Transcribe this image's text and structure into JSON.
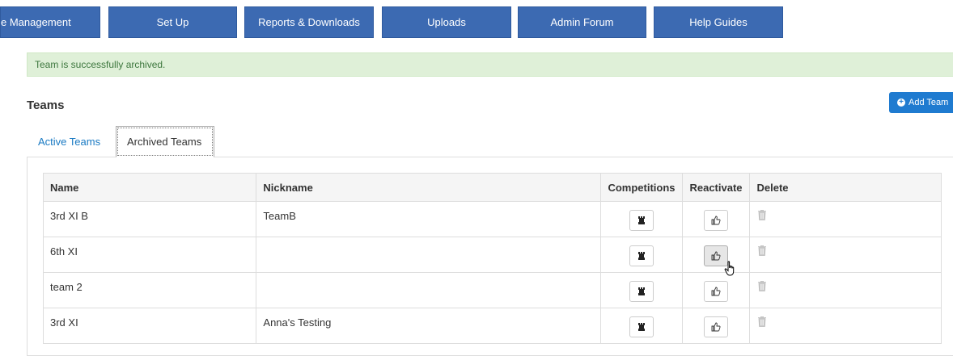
{
  "nav": {
    "items": [
      {
        "label": "e Management"
      },
      {
        "label": "Set Up"
      },
      {
        "label": "Reports & Downloads"
      },
      {
        "label": "Uploads"
      },
      {
        "label": "Admin Forum"
      },
      {
        "label": "Help Guides"
      }
    ],
    "color": "#3c6ab2"
  },
  "alert": {
    "text": "Team is successfully archived.",
    "color": "#dff0d8"
  },
  "page": {
    "heading": "Teams",
    "add_button": "Add Team"
  },
  "tabs": [
    {
      "label": "Active Teams",
      "selected": false
    },
    {
      "label": "Archived Teams",
      "selected": true
    }
  ],
  "table": {
    "headers": {
      "name": "Name",
      "nickname": "Nickname",
      "competitions": "Competitions",
      "reactivate": "Reactivate",
      "delete": "Delete"
    },
    "rows": [
      {
        "name": "3rd XI B",
        "nickname": "TeamB"
      },
      {
        "name": "6th XI",
        "nickname": ""
      },
      {
        "name": "team 2",
        "nickname": ""
      },
      {
        "name": "3rd XI",
        "nickname": "Anna's Testing"
      }
    ]
  },
  "icons": {
    "competitions": "chess-rook-icon",
    "reactivate": "thumbs-up-icon",
    "delete": "trash-icon",
    "add": "plus-circle-icon",
    "cursor": "hand-pointer-icon"
  }
}
